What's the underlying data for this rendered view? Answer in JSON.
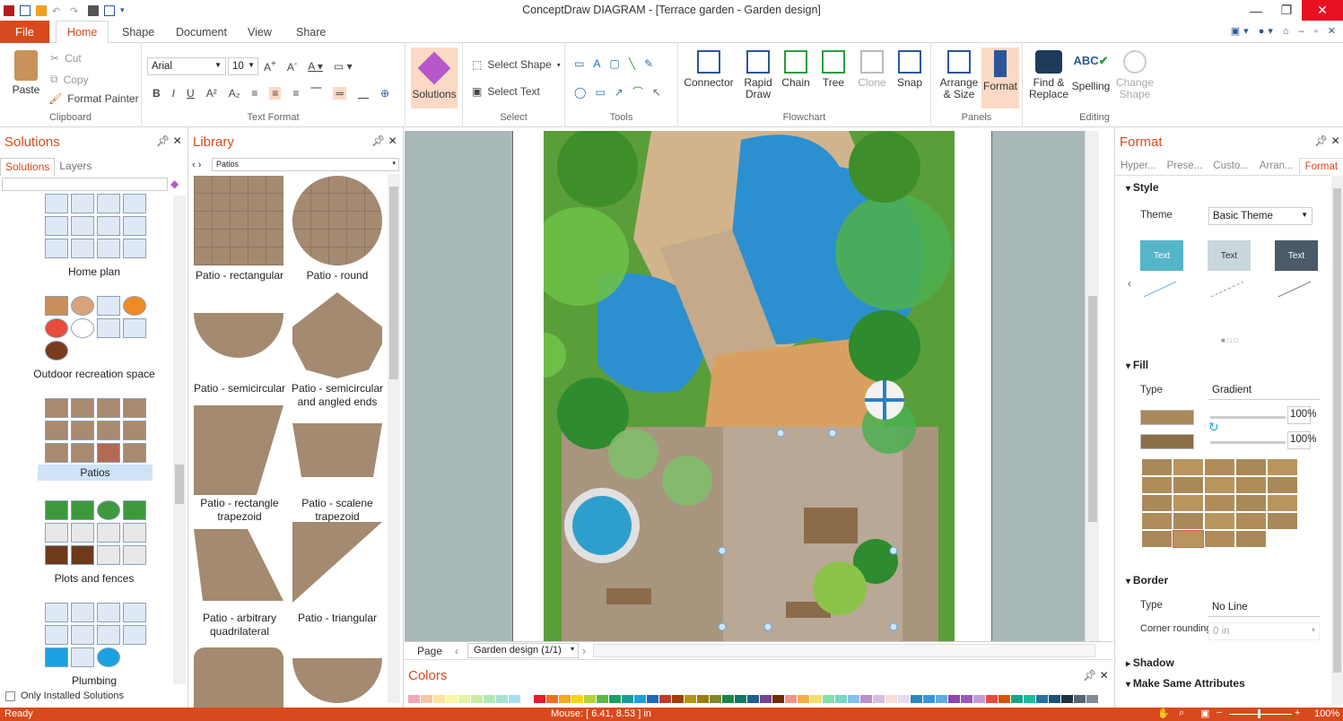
{
  "window": {
    "title": "ConceptDraw DIAGRAM - [Terrace garden - Garden design]"
  },
  "ribbon": {
    "file_tab": "File",
    "tabs": [
      "Home",
      "Shape",
      "Document",
      "View",
      "Share"
    ],
    "clipboard": {
      "paste": "Paste",
      "cut": "Cut",
      "copy": "Copy",
      "format_painter": "Format Painter",
      "label": "Clipboard"
    },
    "text_format": {
      "font": "Arial",
      "size": "10",
      "label": "Text Format"
    },
    "solutions_btn": "Solutions",
    "select": {
      "select_shape": "Select Shape",
      "select_text": "Select Text",
      "label": "Select"
    },
    "tools": {
      "label": "Tools"
    },
    "flowchart": {
      "connector": "Connector",
      "rapid_draw": "Rapid Draw",
      "chain": "Chain",
      "tree": "Tree",
      "clone": "Clone",
      "snap": "Snap",
      "label": "Flowchart"
    },
    "panels": {
      "arrange": "Arrange & Size",
      "format": "Format",
      "label": "Panels"
    },
    "editing": {
      "find": "Find & Replace",
      "spelling": "Spelling",
      "change_shape": "Change Shape",
      "label": "Editing"
    }
  },
  "solutions": {
    "title": "Solutions",
    "tabs": [
      "Solutions",
      "Layers"
    ],
    "groups": [
      "Home plan",
      "Outdoor recreation space",
      "Patios",
      "Plots and fences",
      "Plumbing"
    ],
    "only_installed": "Only Installed Solutions"
  },
  "library": {
    "title": "Library",
    "selected": "Patios",
    "items": [
      "Patio - rectangular",
      "Patio - round",
      "Patio - semicircular",
      "Patio - semicircular and angled ends",
      "Patio - rectangle trapezoid",
      "Patio - scalene trapezoid",
      "Patio - arbitrary quadrilateral",
      "Patio - triangular"
    ]
  },
  "pagebar": {
    "page_label": "Page",
    "page_name": "Garden design (1/1)"
  },
  "colors": {
    "title": "Colors",
    "palette": [
      "#f4a7b9",
      "#f7c6a3",
      "#fbe3a0",
      "#fdf5a6",
      "#e5f3a5",
      "#c9eda5",
      "#b3e6b5",
      "#a7e2d2",
      "#a9dff0",
      "#ffffff",
      "#e8192c",
      "#f26d21",
      "#f7a81b",
      "#f5d51b",
      "#b5d334",
      "#5cb948",
      "#19a15f",
      "#16a093",
      "#1ba1e2",
      "#2066bc",
      "#c0392b",
      "#a04000",
      "#b7950b",
      "#9a7d0a",
      "#7d8a2e",
      "#1e8449",
      "#117864",
      "#1f618d",
      "#76448a",
      "#6e2c00",
      "#f1948a",
      "#f5b041",
      "#f7dc6f",
      "#82e0aa",
      "#76d7c4",
      "#85c1e9",
      "#bb8fce",
      "#d7bde2",
      "#fadbd8",
      "#e8daef",
      "#2e86c1",
      "#3498db",
      "#5dade2",
      "#8e44ad",
      "#9b59b6",
      "#c39bd3",
      "#e74c3c",
      "#d35400",
      "#17a589",
      "#1abc9c",
      "#2471a3",
      "#1a5276",
      "#212f3c",
      "#566573",
      "#808b96",
      "#abb2b9",
      "#000000"
    ]
  },
  "format": {
    "title": "Format",
    "tabs": [
      "Hyper...",
      "Prese...",
      "Custo...",
      "Arran...",
      "Format"
    ],
    "style": {
      "header": "Style",
      "theme_label": "Theme",
      "theme_value": "Basic Theme",
      "swatch_text": "Text"
    },
    "fill": {
      "header": "Fill",
      "type_label": "Type",
      "type_value": "Gradient",
      "opacity1": "100",
      "opacity2": "100",
      "color1": "#a9895a",
      "color2": "#8a7048"
    },
    "border": {
      "header": "Border",
      "type_label": "Type",
      "type_value": "No Line",
      "corner_label": "Corner rounding",
      "corner_value": "0 in"
    },
    "shadow": {
      "header": "Shadow"
    },
    "make_same": {
      "header": "Make Same Attributes"
    }
  },
  "status": {
    "left": "Ready",
    "mouse": "Mouse: [ 6.41, 8.53 ] in",
    "zoom": "100%"
  }
}
